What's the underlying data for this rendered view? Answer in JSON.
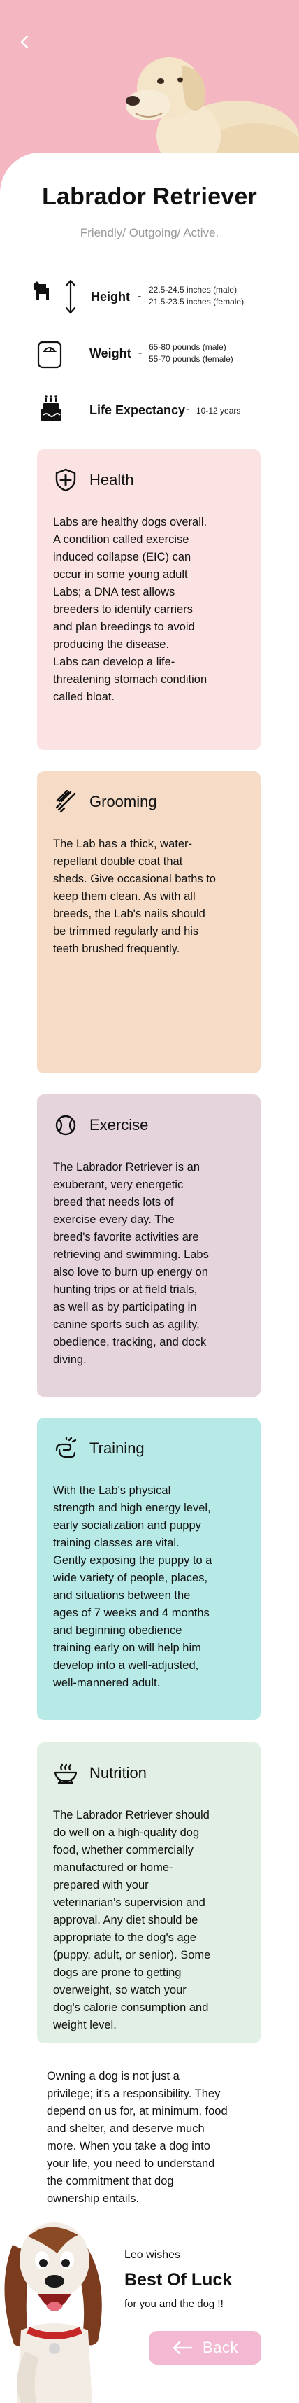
{
  "header": {
    "title": "Labrador Retriever",
    "subtitle": "Friendly/ Outgoing/ Active.",
    "back_icon": "chevron-left-icon",
    "hero_image": "labrador-photo"
  },
  "stats": {
    "height": {
      "label": "Height",
      "dash": "-",
      "value_male": "22.5-24.5 inches (male)",
      "value_female": "21.5-23.5 inches (female)",
      "icon": "dog-height-icon"
    },
    "weight": {
      "label": "Weight",
      "dash": "-",
      "value_male": "65-80 pounds (male)",
      "value_female": "55-70 pounds (female)",
      "icon": "scale-icon"
    },
    "life": {
      "label": "Life Expectancy",
      "dash": "-",
      "value": "10-12 years",
      "icon": "birthday-cake-icon"
    }
  },
  "cards": {
    "health": {
      "title": "Health",
      "icon": "shield-plus-icon",
      "body": "Labs are healthy dogs overall.\nA condition called exercise\ninduced collapse (EIC) can\noccur in some young adult\nLabs; a DNA test allows\nbreeders to identify carriers\nand plan breedings to avoid\nproducing the disease.\nLabs can develop a life-\nthreatening stomach condition\ncalled bloat."
    },
    "grooming": {
      "title": "Grooming",
      "icon": "comb-icon",
      "body": "The Lab has a thick, water-\nrepellant double coat that\nsheds. Give occasional baths to\nkeep them clean. As with all\nbreeds, the Lab's nails should\nbe trimmed regularly and his\nteeth brushed frequently."
    },
    "exercise": {
      "title": "Exercise",
      "icon": "ball-icon",
      "body": "The Labrador Retriever is an\nexuberant, very energetic\nbreed that needs lots of\nexercise every day.  The\nbreed's favorite activities are\nretrieving and swimming. Labs\nalso love to burn up energy on\nhunting trips or at field trials,\nas well as by participating in\ncanine sports such as agility,\nobedience, tracking, and dock\ndiving."
    },
    "training": {
      "title": "Training",
      "icon": "training-hand-icon",
      "body": "With the Lab's physical\nstrength and high energy level,\nearly socialization and puppy\ntraining classes are vital.\nGently exposing the puppy to a\nwide variety of people, places,\nand situations between the\nages of 7 weeks and 4 months\nand beginning obedience\ntraining early on will help him\ndevelop into a well-adjusted,\nwell-mannered adult."
    },
    "nutrition": {
      "title": "Nutrition",
      "icon": "food-bowl-icon",
      "body": "The Labrador Retriever should\ndo well on a high-quality dog\nfood, whether commercially\nmanufactured or home-\nprepared with your\nveterinarian's supervision and\napproval. Any diet should be\nappropriate to the dog's age\n(puppy, adult, or senior). Some\ndogs are prone to getting\noverweight, so watch your\ndog's calorie consumption and\nweight level."
    }
  },
  "closing": {
    "text": "Owning a dog is not just a\nprivilege; it's a responsibility. They\ndepend on us for, at minimum, food\nand shelter, and deserve much\nmore. When you take a dog into\nyour life, you need to understand\nthe commitment that dog\nownership entails.",
    "wishes": "Leo wishes",
    "best_luck": "Best Of Luck",
    "for_you": "for you and the dog !!"
  },
  "back_button": {
    "label": "Back",
    "icon": "arrow-left-icon",
    "color": "#f3b9d2"
  },
  "colors": {
    "hero": "#f4b7c1",
    "health": "#fbe3e3",
    "grooming": "#f6dcc6",
    "exercise": "#e5d4dc",
    "training": "#b7eae7",
    "nutrition": "#e2efe4"
  }
}
